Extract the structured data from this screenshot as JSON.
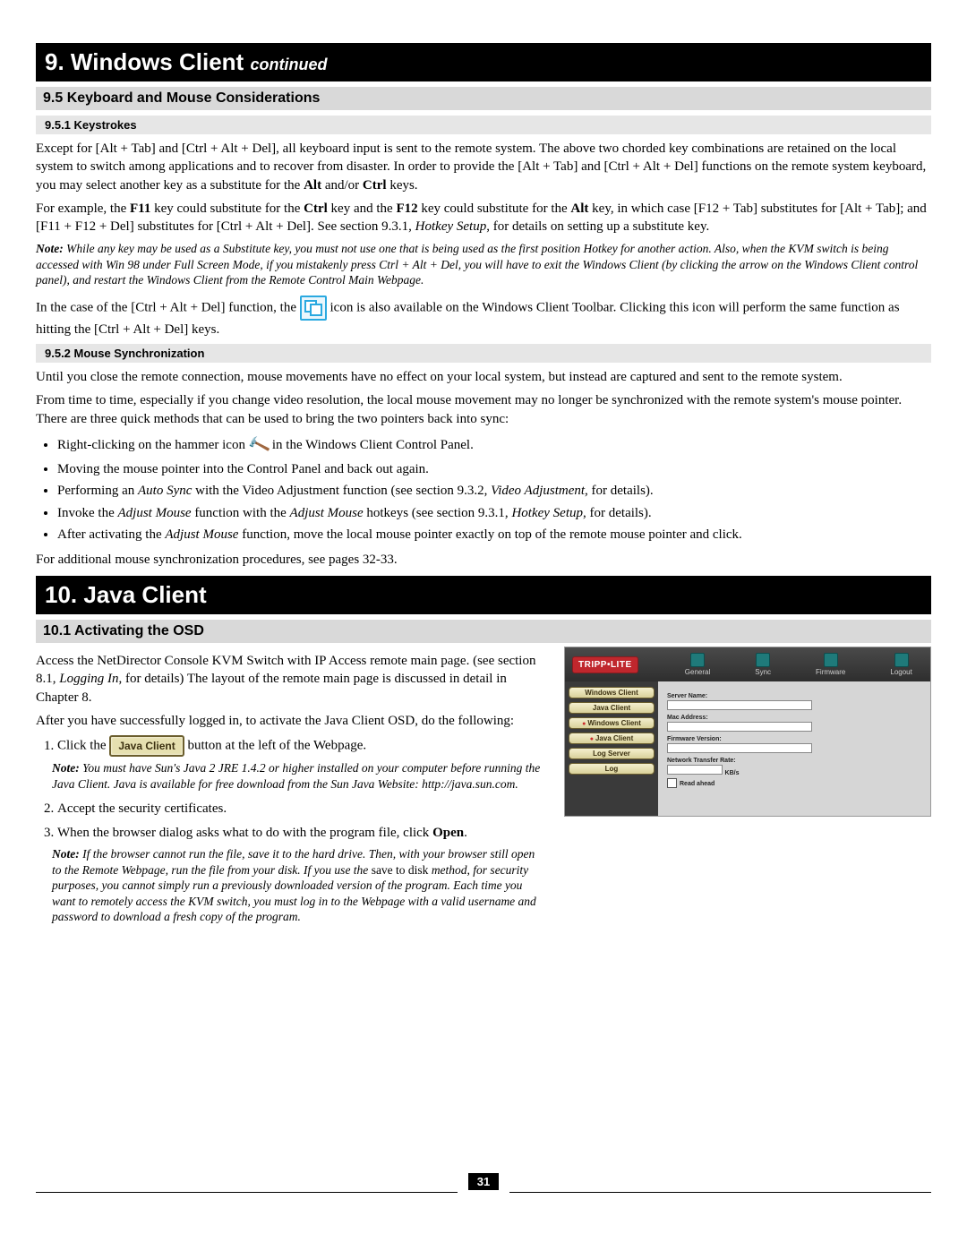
{
  "sections": {
    "windows_client": {
      "title_prefix": "9. Windows Client ",
      "title_cont": "continued",
      "sub95": "9.5 Keyboard and Mouse Considerations",
      "sub951": "9.5.1 Keystrokes",
      "sub952": "9.5.2 Mouse Synchronization"
    },
    "java_client": {
      "title": "10. Java Client",
      "sub101": "10.1 Activating the OSD"
    }
  },
  "para": {
    "ks1a": "Except for [Alt + Tab] and [Ctrl + Alt + Del], all keyboard input is sent to the remote system. The above two chorded key combinations are retained on the local system to switch among applications and to recover from disaster. In order to provide the [Alt + Tab] and [Ctrl + Alt + Del] functions on the remote system keyboard, you may select another key as a substitute for the ",
    "ks1b": " and/or ",
    "ks1c": " keys.",
    "ks2_pre": "For example, the ",
    "ks2_f11": "F11",
    "ks2_a": " key could substitute for the ",
    "ks2_ctrl": "Ctrl",
    "ks2_b": " key and the ",
    "ks2_f12": "F12",
    "ks2_c": " key could substitute for the ",
    "ks2_alt": "Alt",
    "ks2_d": " key, in which case [F12 + Tab] substitutes for [Alt + Tab]; and [F11 + F12 + Del] substitutes for [Ctrl + Alt + Del]. See section 9.3.1, ",
    "ks2_hk": "Hotkey Setup",
    "ks2_e": ", for details on setting up a substitute key.",
    "note1_lbl": "Note:",
    "note1": " While any key may be used as a Substitute key, you must not use one that is being used as the first position Hotkey for another action. Also, when the KVM switch is being accessed with Win 98 under Full Screen Mode, if you mistakenly press Ctrl + Alt + Del, you will have to exit the Windows Client (by clicking the arrow on the Windows Client control panel), and restart the Windows Client from the Remote Control Main Webpage.",
    "ks3a": "In the case of the [Ctrl + Alt + Del] function, the ",
    "ks3b": " icon is also available on the Windows Client Toolbar. Clicking this icon will perform the same function as hitting the [Ctrl + Alt + Del] keys.",
    "ms1": "Until you close the remote connection, mouse movements have no effect on your local system, but instead are captured and sent to the remote system.",
    "ms2": "From time to time, especially if you change video resolution, the local mouse movement may no longer be synchronized with the remote system's mouse pointer. There are three quick methods that can be used to bring the two pointers back into sync:",
    "b1a": "Right-clicking on the hammer icon ",
    "b1b": " in the Windows Client Control Panel.",
    "b2": "Moving the mouse pointer into the Control Panel and back out again.",
    "b3a": "Performing an ",
    "b3_auto": "Auto Sync",
    "b3b": " with the Video Adjustment function (see section 9.3.2, ",
    "b3_va": "Video Adjustment",
    "b3c": ", for details).",
    "b4a": "Invoke the ",
    "b4_am": "Adjust Mouse",
    "b4b": " function with the ",
    "b4c": " hotkeys (see section 9.3.1, ",
    "b4_hk": "Hotkey Setup",
    "b4d": ", for details).",
    "b5a": "After activating the ",
    "b5b": " function, move the local mouse pointer exactly on top of the remote mouse pointer and click.",
    "ms3": "For additional mouse synchronization procedures, see pages 32-33.",
    "jc1a": "Access the NetDirector Console KVM Switch with IP Access remote main page. (see section 8.1, ",
    "jc1_li": "Logging In",
    "jc1b": ", for details) The layout of the remote main page is discussed in detail in Chapter 8.",
    "jc2": "After you have successfully logged in, to activate the Java Client OSD, do the following:",
    "step1a": "Click the ",
    "step1b": " button at the left of the Webpage.",
    "note2_lbl": "Note:",
    "note2": " You must have Sun's Java 2 JRE 1.4.2 or higher installed on your computer before running the Java Client. Java is available for free download from the Sun Java Website: http://java.sun.com.",
    "step2": "Accept the security certificates.",
    "step3a": "When the browser dialog asks what to do with the program file, click ",
    "step3_open": "Open",
    "step3b": ".",
    "note3_lbl": "Note:",
    "note3a": " If the browser cannot run the file, save it to the hard drive. Then, with your browser still open to the Remote Webpage, run the file from your disk. If you use the ",
    "note3_std": "save to disk",
    "note3b": " method, for security purposes, you cannot simply run a previously downloaded version of the program. Each time you want to remotely access the KVM switch, you must log in to the Webpage with a valid username and password to download a fresh copy of the program.",
    "alt_bold": "Alt",
    "ctrl_bold": "Ctrl"
  },
  "webshot": {
    "logo": "TRIPP•LITE",
    "nav": [
      "General",
      "Sync",
      "Firmware",
      "Logout"
    ],
    "side": [
      "Windows Client",
      "Java Client",
      "Windows Client",
      "Java Client",
      "Log Server",
      "Log"
    ],
    "fields": {
      "f1": "Server Name:",
      "f2": "Mac Address:",
      "f3": "Firmware Version:",
      "f4": "Network Transfer Rate:",
      "unit": "KB/s",
      "chk": "Read ahead"
    }
  },
  "java_btn": "Java Client",
  "page_num": "31"
}
